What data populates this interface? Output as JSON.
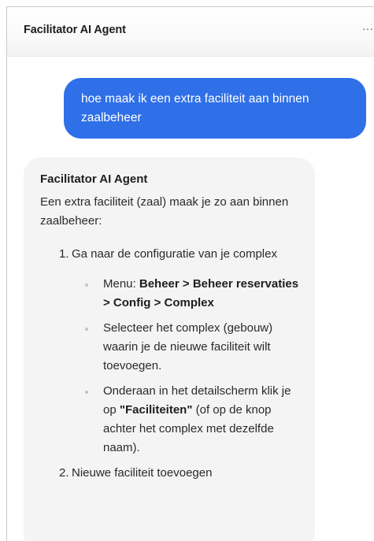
{
  "header": {
    "title": "Facilitator AI Agent",
    "menu_icon": "more-horizontal-icon",
    "menu_label": "···"
  },
  "colors": {
    "user_bubble": "#2f6fe8",
    "agent_bubble": "#f4f4f5"
  },
  "messages": {
    "user": {
      "text": "hoe maak ik een extra faciliteit aan binnen zaalbeheer"
    },
    "agent": {
      "name": "Facilitator AI Agent",
      "intro": "Een extra faciliteit (zaal) maak je zo aan binnen zaalbeheer:",
      "steps": [
        {
          "number": "1.",
          "text": "Ga naar de configuratie van je complex",
          "bullets": [
            {
              "prefix": "Menu: ",
              "bold": "Beheer > Beheer reservaties > Config > Complex",
              "suffix": ""
            },
            {
              "prefix": "Selecteer het complex (gebouw) waarin je de nieuwe faciliteit wilt toevoegen.",
              "bold": "",
              "suffix": ""
            },
            {
              "prefix": "Onderaan in het detailscherm klik je op ",
              "bold": "\"Faciliteiten\"",
              "suffix": " (of op de knop achter het complex met dezelfde naam)."
            }
          ]
        },
        {
          "number": "2.",
          "text": "Nieuwe faciliteit toevoegen",
          "bullets": []
        }
      ]
    }
  }
}
